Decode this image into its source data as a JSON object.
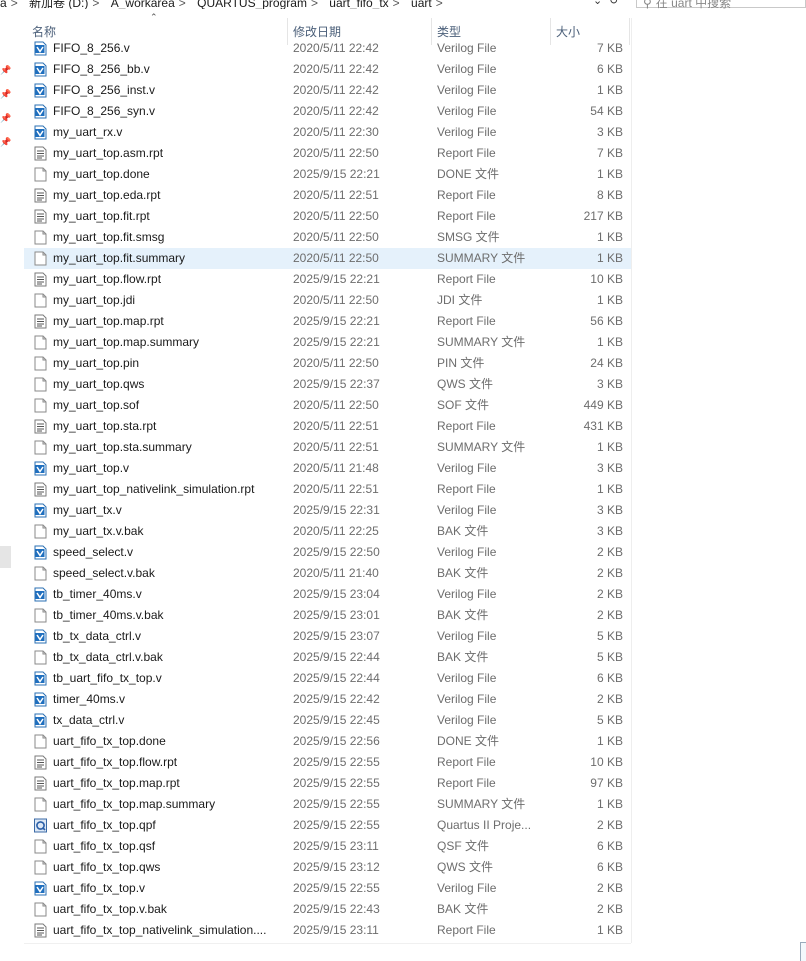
{
  "breadcrumb": {
    "items": [
      "a",
      "新加卷 (D:)",
      "A_workarea",
      "QUARTUS_program",
      "uart_fifo_tx",
      "uart"
    ],
    "separator": ">"
  },
  "search": {
    "placeholder": "在 uart 中搜索"
  },
  "columns": {
    "name": "名称",
    "date": "修改日期",
    "type": "类型",
    "size": "大小"
  },
  "icons": {
    "verilog": "verilog-file-icon",
    "report": "report-file-icon",
    "blank": "blank-file-icon",
    "quartus": "quartus-project-icon",
    "pin": "pin-icon",
    "sort": "sort-ascending-icon"
  },
  "colors": {
    "selected_row": "#e5f1fb",
    "header_text": "#4c607a",
    "secondary_text": "#6d6d6d"
  },
  "files": [
    {
      "name": "FIFO_8_256.v",
      "date": "2020/5/11 22:42",
      "type": "Verilog File",
      "size": "7 KB",
      "icon": "verilog"
    },
    {
      "name": "FIFO_8_256_bb.v",
      "date": "2020/5/11 22:42",
      "type": "Verilog File",
      "size": "6 KB",
      "icon": "verilog"
    },
    {
      "name": "FIFO_8_256_inst.v",
      "date": "2020/5/11 22:42",
      "type": "Verilog File",
      "size": "1 KB",
      "icon": "verilog"
    },
    {
      "name": "FIFO_8_256_syn.v",
      "date": "2020/5/11 22:42",
      "type": "Verilog File",
      "size": "54 KB",
      "icon": "verilog"
    },
    {
      "name": "my_uart_rx.v",
      "date": "2020/5/11 22:30",
      "type": "Verilog File",
      "size": "3 KB",
      "icon": "verilog"
    },
    {
      "name": "my_uart_top.asm.rpt",
      "date": "2020/5/11 22:50",
      "type": "Report File",
      "size": "7 KB",
      "icon": "report"
    },
    {
      "name": "my_uart_top.done",
      "date": "2025/9/15 22:21",
      "type": "DONE 文件",
      "size": "1 KB",
      "icon": "blank"
    },
    {
      "name": "my_uart_top.eda.rpt",
      "date": "2020/5/11 22:51",
      "type": "Report File",
      "size": "8 KB",
      "icon": "report"
    },
    {
      "name": "my_uart_top.fit.rpt",
      "date": "2020/5/11 22:50",
      "type": "Report File",
      "size": "217 KB",
      "icon": "report"
    },
    {
      "name": "my_uart_top.fit.smsg",
      "date": "2020/5/11 22:50",
      "type": "SMSG 文件",
      "size": "1 KB",
      "icon": "blank"
    },
    {
      "name": "my_uart_top.fit.summary",
      "date": "2020/5/11 22:50",
      "type": "SUMMARY 文件",
      "size": "1 KB",
      "icon": "blank",
      "selected": true
    },
    {
      "name": "my_uart_top.flow.rpt",
      "date": "2025/9/15 22:21",
      "type": "Report File",
      "size": "10 KB",
      "icon": "report"
    },
    {
      "name": "my_uart_top.jdi",
      "date": "2020/5/11 22:50",
      "type": "JDI 文件",
      "size": "1 KB",
      "icon": "blank"
    },
    {
      "name": "my_uart_top.map.rpt",
      "date": "2025/9/15 22:21",
      "type": "Report File",
      "size": "56 KB",
      "icon": "report"
    },
    {
      "name": "my_uart_top.map.summary",
      "date": "2025/9/15 22:21",
      "type": "SUMMARY 文件",
      "size": "1 KB",
      "icon": "blank"
    },
    {
      "name": "my_uart_top.pin",
      "date": "2020/5/11 22:50",
      "type": "PIN 文件",
      "size": "24 KB",
      "icon": "blank"
    },
    {
      "name": "my_uart_top.qws",
      "date": "2025/9/15 22:37",
      "type": "QWS 文件",
      "size": "3 KB",
      "icon": "blank"
    },
    {
      "name": "my_uart_top.sof",
      "date": "2020/5/11 22:50",
      "type": "SOF 文件",
      "size": "449 KB",
      "icon": "blank"
    },
    {
      "name": "my_uart_top.sta.rpt",
      "date": "2020/5/11 22:51",
      "type": "Report File",
      "size": "431 KB",
      "icon": "report"
    },
    {
      "name": "my_uart_top.sta.summary",
      "date": "2020/5/11 22:51",
      "type": "SUMMARY 文件",
      "size": "1 KB",
      "icon": "blank"
    },
    {
      "name": "my_uart_top.v",
      "date": "2020/5/11 21:48",
      "type": "Verilog File",
      "size": "3 KB",
      "icon": "verilog"
    },
    {
      "name": "my_uart_top_nativelink_simulation.rpt",
      "date": "2020/5/11 22:51",
      "type": "Report File",
      "size": "1 KB",
      "icon": "report"
    },
    {
      "name": "my_uart_tx.v",
      "date": "2025/9/15 22:31",
      "type": "Verilog File",
      "size": "3 KB",
      "icon": "verilog"
    },
    {
      "name": "my_uart_tx.v.bak",
      "date": "2020/5/11 22:25",
      "type": "BAK 文件",
      "size": "3 KB",
      "icon": "blank"
    },
    {
      "name": "speed_select.v",
      "date": "2025/9/15 22:50",
      "type": "Verilog File",
      "size": "2 KB",
      "icon": "verilog"
    },
    {
      "name": "speed_select.v.bak",
      "date": "2020/5/11 21:40",
      "type": "BAK 文件",
      "size": "2 KB",
      "icon": "blank"
    },
    {
      "name": "tb_timer_40ms.v",
      "date": "2025/9/15 23:04",
      "type": "Verilog File",
      "size": "2 KB",
      "icon": "verilog"
    },
    {
      "name": "tb_timer_40ms.v.bak",
      "date": "2025/9/15 23:01",
      "type": "BAK 文件",
      "size": "2 KB",
      "icon": "blank"
    },
    {
      "name": "tb_tx_data_ctrl.v",
      "date": "2025/9/15 23:07",
      "type": "Verilog File",
      "size": "5 KB",
      "icon": "verilog"
    },
    {
      "name": "tb_tx_data_ctrl.v.bak",
      "date": "2025/9/15 22:44",
      "type": "BAK 文件",
      "size": "5 KB",
      "icon": "blank"
    },
    {
      "name": "tb_uart_fifo_tx_top.v",
      "date": "2025/9/15 22:44",
      "type": "Verilog File",
      "size": "6 KB",
      "icon": "verilog"
    },
    {
      "name": "timer_40ms.v",
      "date": "2025/9/15 22:42",
      "type": "Verilog File",
      "size": "2 KB",
      "icon": "verilog"
    },
    {
      "name": "tx_data_ctrl.v",
      "date": "2025/9/15 22:45",
      "type": "Verilog File",
      "size": "5 KB",
      "icon": "verilog"
    },
    {
      "name": "uart_fifo_tx_top.done",
      "date": "2025/9/15 22:56",
      "type": "DONE 文件",
      "size": "1 KB",
      "icon": "blank"
    },
    {
      "name": "uart_fifo_tx_top.flow.rpt",
      "date": "2025/9/15 22:55",
      "type": "Report File",
      "size": "10 KB",
      "icon": "report"
    },
    {
      "name": "uart_fifo_tx_top.map.rpt",
      "date": "2025/9/15 22:55",
      "type": "Report File",
      "size": "97 KB",
      "icon": "report"
    },
    {
      "name": "uart_fifo_tx_top.map.summary",
      "date": "2025/9/15 22:55",
      "type": "SUMMARY 文件",
      "size": "1 KB",
      "icon": "blank"
    },
    {
      "name": "uart_fifo_tx_top.qpf",
      "date": "2025/9/15 22:55",
      "type": "Quartus II Proje...",
      "size": "2 KB",
      "icon": "quartus"
    },
    {
      "name": "uart_fifo_tx_top.qsf",
      "date": "2025/9/15 23:11",
      "type": "QSF 文件",
      "size": "6 KB",
      "icon": "blank"
    },
    {
      "name": "uart_fifo_tx_top.qws",
      "date": "2025/9/15 23:12",
      "type": "QWS 文件",
      "size": "6 KB",
      "icon": "blank"
    },
    {
      "name": "uart_fifo_tx_top.v",
      "date": "2025/9/15 22:55",
      "type": "Verilog File",
      "size": "2 KB",
      "icon": "verilog"
    },
    {
      "name": "uart_fifo_tx_top.v.bak",
      "date": "2025/9/15 22:43",
      "type": "BAK 文件",
      "size": "2 KB",
      "icon": "blank"
    },
    {
      "name": "uart_fifo_tx_top_nativelink_simulation....",
      "date": "2025/9/15 23:11",
      "type": "Report File",
      "size": "1 KB",
      "icon": "report"
    }
  ]
}
